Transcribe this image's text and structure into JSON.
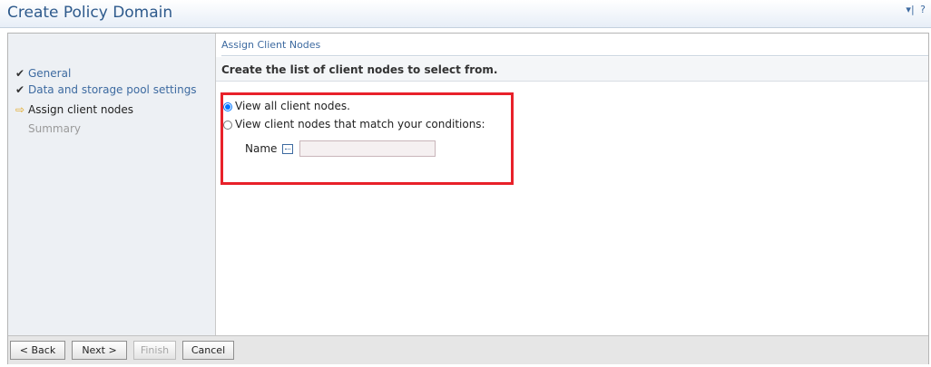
{
  "window": {
    "title": "Create Policy Domain",
    "controls": [
      "▾|",
      "?"
    ]
  },
  "steps": [
    {
      "label": "General",
      "state": "done"
    },
    {
      "label": "Data and storage pool settings",
      "state": "done"
    },
    {
      "label": "Assign client nodes",
      "state": "current"
    },
    {
      "label": "Summary",
      "state": "pending"
    }
  ],
  "content": {
    "section_title": "Assign Client Nodes",
    "instruction": "Create the list of client nodes to select from.",
    "options": [
      {
        "label": "View all client nodes.",
        "selected": true
      },
      {
        "label": "View client nodes that match your conditions:",
        "selected": false
      }
    ],
    "name_field": {
      "label": "Name",
      "value": ""
    }
  },
  "buttons": {
    "back": "< Back",
    "next": "Next >",
    "finish": "Finish",
    "cancel": "Cancel"
  },
  "colors": {
    "title": "#2e5a8c",
    "link": "#3d6aa0",
    "current_arrow": "#e2a822",
    "highlight": "#e8212a"
  }
}
